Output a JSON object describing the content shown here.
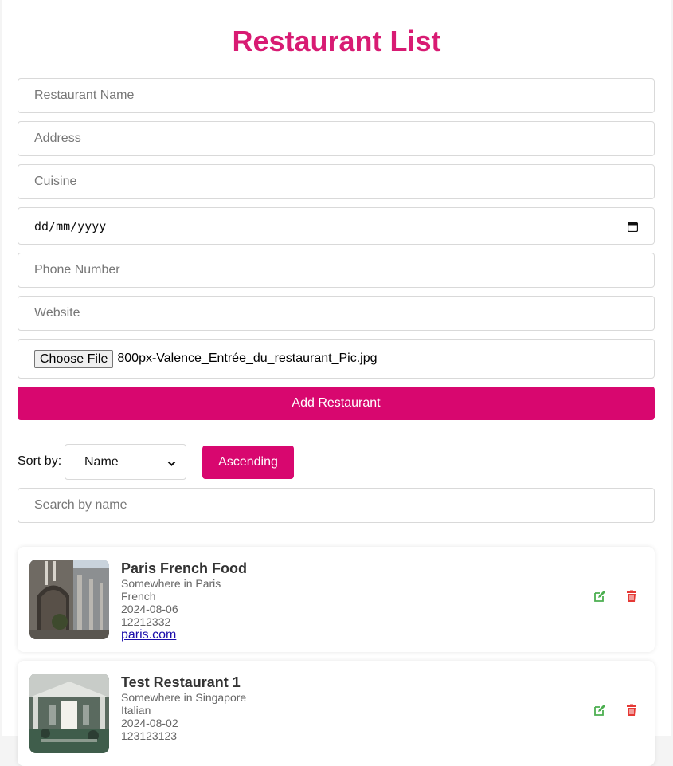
{
  "title": "Restaurant List",
  "form": {
    "name_placeholder": "Restaurant Name",
    "address_placeholder": "Address",
    "cuisine_placeholder": "Cuisine",
    "date_placeholder": "dd/mm/yyyy",
    "phone_placeholder": "Phone Number",
    "website_placeholder": "Website",
    "file_button": "Choose File",
    "file_name": "800px-Valence_Entrée_du_restaurant_Pic.jpg",
    "submit_label": "Add Restaurant"
  },
  "controls": {
    "sort_label": "Sort by:",
    "sort_value": "Name",
    "order_label": "Ascending",
    "search_placeholder": "Search by name"
  },
  "restaurants": [
    {
      "name": "Paris French Food",
      "address": "Somewhere in Paris",
      "cuisine": "French",
      "date": "2024-08-06",
      "phone": "12212332",
      "website": "paris.com"
    },
    {
      "name": "Test Restaurant 1",
      "address": "Somewhere in Singapore",
      "cuisine": "Italian",
      "date": "2024-08-02",
      "phone": "123123123",
      "website": ""
    }
  ],
  "icons": {
    "edit": "edit-icon",
    "delete": "trash-icon",
    "calendar": "calendar-icon",
    "chevron": "chevron-down-icon"
  },
  "colors": {
    "accent": "#d8076f",
    "title": "#d81b73",
    "edit": "#4caf50",
    "delete": "#e53935",
    "link": "#1a0dab"
  }
}
